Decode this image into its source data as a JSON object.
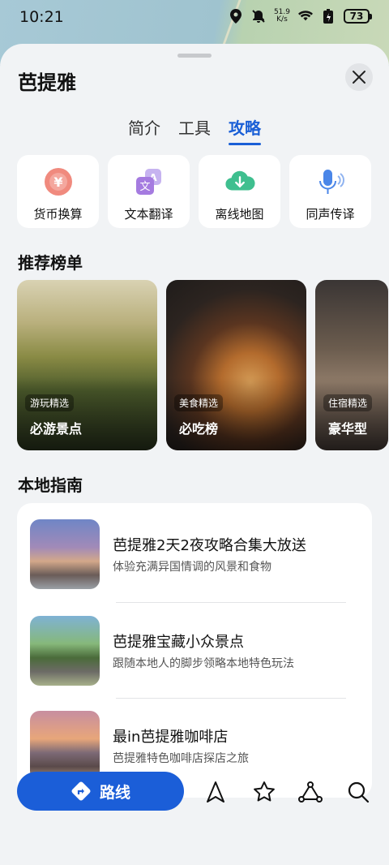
{
  "status_bar": {
    "time": "10:21",
    "net_speed_value": "51.9",
    "net_speed_unit": "K/s",
    "battery": "73"
  },
  "sheet": {
    "title": "芭提雅"
  },
  "tabs": [
    {
      "label": "简介"
    },
    {
      "label": "工具"
    },
    {
      "label": "攻略"
    }
  ],
  "tools": [
    {
      "label": "货币换算",
      "icon": "currency-exchange-icon"
    },
    {
      "label": "文本翻译",
      "icon": "text-translate-icon"
    },
    {
      "label": "离线地图",
      "icon": "offline-map-icon"
    },
    {
      "label": "同声传译",
      "icon": "simultaneous-interpretation-icon"
    }
  ],
  "recommend": {
    "title": "推荐榜单",
    "cards": [
      {
        "tag": "游玩精选",
        "name": "必游景点"
      },
      {
        "tag": "美食精选",
        "name": "必吃榜"
      },
      {
        "tag": "住宿精选",
        "name": "豪华型"
      }
    ]
  },
  "guide": {
    "title": "本地指南",
    "items": [
      {
        "title": "芭提雅2天2夜攻略合集大放送",
        "subtitle": "体验充满异国情调的风景和食物"
      },
      {
        "title": "芭提雅宝藏小众景点",
        "subtitle": "跟随本地人的脚步领略本地特色玩法"
      },
      {
        "title": "最in芭提雅咖啡店",
        "subtitle": "芭提雅特色咖啡店探店之旅"
      }
    ]
  },
  "bottom": {
    "route_label": "路线"
  },
  "colors": {
    "accent": "#1b5ed8",
    "sheet_bg": "#f1f3f5"
  }
}
